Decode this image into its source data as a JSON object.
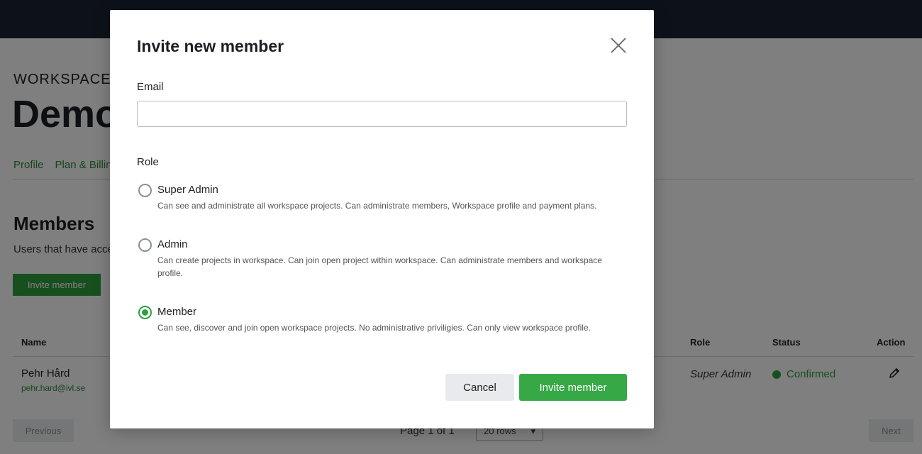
{
  "colors": {
    "accent": "#36a846",
    "topbar": "#1b2535",
    "link": "#2e8b3a"
  },
  "background": {
    "workspace_label": "WORKSPACE",
    "workspace_name": "Demo",
    "tabs": [
      "Profile",
      "Plan & Billing"
    ],
    "members_title": "Members",
    "members_desc": "Users that have access",
    "invite_button": "Invite member",
    "table": {
      "headers": {
        "name": "Name",
        "role": "Role",
        "status": "Status",
        "action": "Action"
      },
      "rows": [
        {
          "name": "Pehr Hård",
          "email": "pehr.hard@ivl.se",
          "role": "Super Admin",
          "status": "Confirmed",
          "action_icon": "pencil-icon"
        }
      ]
    },
    "pager": {
      "previous": "Previous",
      "info": "Page 1 of 1",
      "rows": "20 rows",
      "next": "Next"
    }
  },
  "modal": {
    "title": "Invite new member",
    "close_icon": "close-icon",
    "email_label": "Email",
    "email_value": "",
    "role_label": "Role",
    "options": [
      {
        "label": "Super Admin",
        "desc": "Can see and administrate all workspace projects. Can administrate members, Workspace profile and payment plans.",
        "checked": false
      },
      {
        "label": "Admin",
        "desc": "Can create projects in workspace. Can join open project within workspace. Can administrate members and workspace profile.",
        "checked": false
      },
      {
        "label": "Member",
        "desc": "Can see, discover and join open workspace projects. No administrative priviligies. Can only view workspace profile.",
        "checked": true
      }
    ],
    "cancel": "Cancel",
    "submit": "Invite member"
  }
}
